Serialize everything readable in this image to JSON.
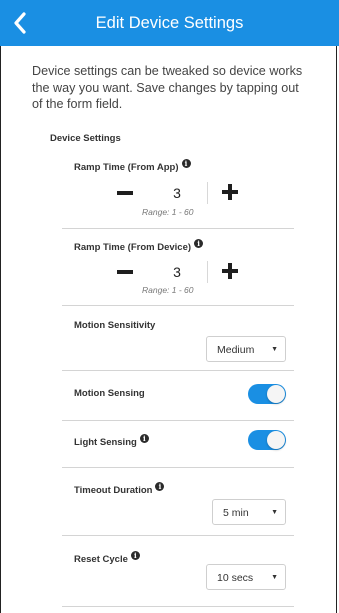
{
  "header": {
    "title": "Edit Device Settings",
    "background": "#1a8fe3"
  },
  "intro": "Device settings can be tweaked so device works the way you want. Save changes by tapping out of the form field.",
  "section_title": "Device Settings",
  "settings": {
    "ramp_app": {
      "label": "Ramp Time (From App)",
      "value": "3",
      "range": "Range: 1 - 60"
    },
    "ramp_device": {
      "label": "Ramp Time (From Device)",
      "value": "3",
      "range": "Range: 1 - 60"
    },
    "motion_sensitivity": {
      "label": "Motion Sensitivity",
      "selected": "Medium"
    },
    "motion_sensing": {
      "label": "Motion Sensing",
      "on": true
    },
    "light_sensing": {
      "label": "Light Sensing",
      "on": true
    },
    "timeout_duration": {
      "label": "Timeout Duration",
      "selected": "5 min"
    },
    "reset_cycle": {
      "label": "Reset Cycle",
      "selected": "10 secs"
    }
  },
  "icons": {
    "back": "chevron-left-icon",
    "info": "info-icon",
    "caret": "caret-down-icon"
  },
  "colors": {
    "accent": "#1a8fe3"
  }
}
